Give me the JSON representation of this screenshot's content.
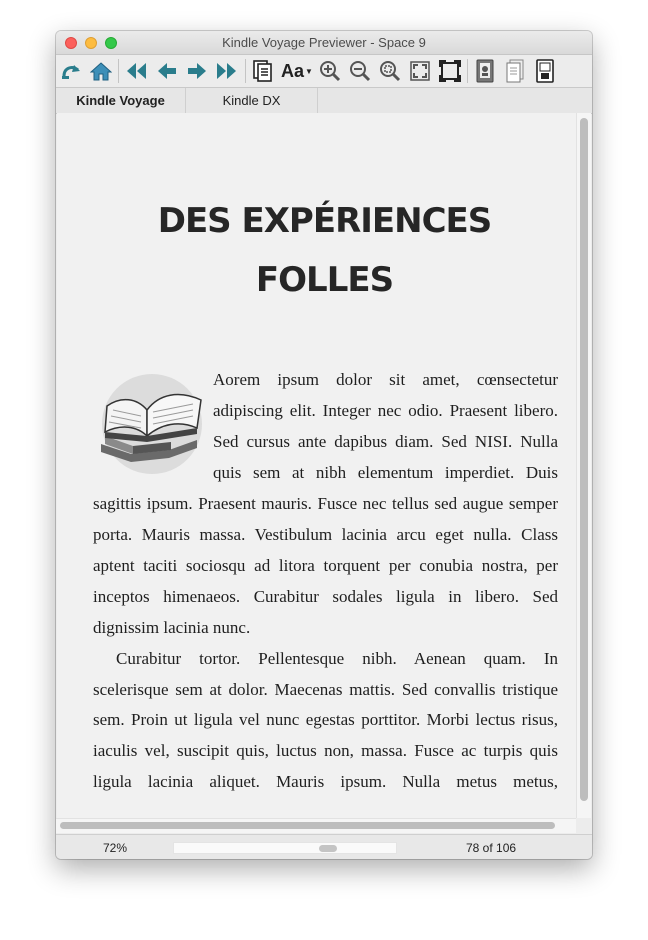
{
  "window": {
    "title": "Kindle Voyage Previewer - Space 9"
  },
  "toolbar": {
    "icons": [
      "rotate-icon",
      "home-icon",
      "first-page-icon",
      "previous-page-icon",
      "next-page-icon",
      "last-page-icon",
      "document-icon",
      "font-settings-icon",
      "zoom-in-icon",
      "zoom-out-icon",
      "zoom-fit-icon",
      "fit-page-icon",
      "full-screen-icon",
      "cover-icon",
      "page-view-icon",
      "device-icon"
    ],
    "font_label": "Aa"
  },
  "tabs": [
    {
      "label": "Kindle Voyage",
      "active": true
    },
    {
      "label": "Kindle DX",
      "active": false
    }
  ],
  "document": {
    "heading_lines": [
      "DES EXPÉRIENCES",
      "FOLLES"
    ],
    "illustration": "open-book-illustration",
    "lines": [
      "Aorem ipsum dolor sit amet, cœnsectetur",
      "adipiscing elit. Integer nec odio. Praesent libero.",
      "Sed cursus ante dapibus diam. Sed NISI. Nulla",
      "quis sem at nibh elementum imperdiet. Duis",
      "sagittis ipsum. Praesent mauris. Fusce nec tellus sed augue semper",
      "porta. Mauris massa. Vestibulum lacinia arcu eget nulla. Class",
      "aptent taciti sociosqu ad litora torquent per conubia nostra, per",
      "inceptos himenaeos. Curabitur sodales ligula in libero. Sed",
      "dignissim lacinia nunc.",
      "Curabitur tortor. Pellentesque nibh. Aenean quam. In",
      "scelerisque sem at dolor. Maecenas mattis. Sed convallis tristique",
      "sem. Proin ut ligula vel nunc egestas porttitor. Morbi lectus risus,",
      "iaculis vel, suscipit quis, luctus non, massa. Fusce ac turpis quis",
      "ligula lacinia aliquet. Mauris ipsum. Nulla metus metus,"
    ]
  },
  "status": {
    "zoom": "72%",
    "reading_progress": 0.71,
    "page_indicator": "78 of 106"
  },
  "colors": {
    "icon_teal": "#2a7d8c",
    "page_background": "#f1f1f1",
    "text": "#1f1f1f"
  }
}
